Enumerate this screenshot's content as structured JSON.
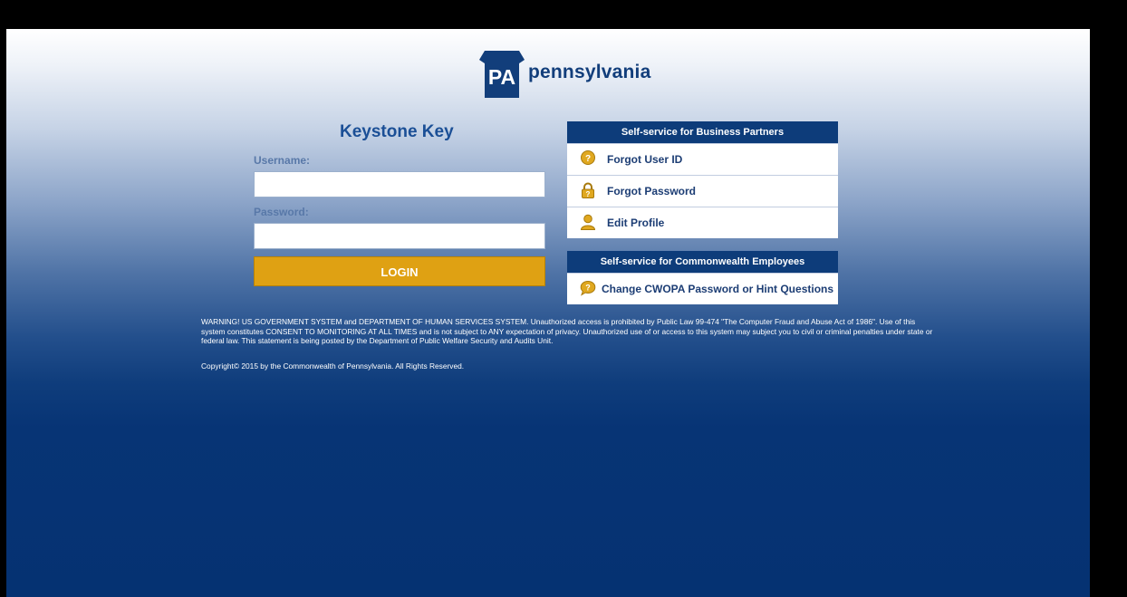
{
  "logo": {
    "badge_text": "PA",
    "name": "pennsylvania"
  },
  "login": {
    "title": "Keystone Key",
    "username_label": "Username:",
    "username_value": "",
    "password_label": "Password:",
    "password_value": "",
    "login_button": "LOGIN"
  },
  "business_partners": {
    "heading": "Self-service for Business Partners",
    "items": [
      {
        "label": "Forgot User ID",
        "icon": "question-circle-icon"
      },
      {
        "label": "Forgot Password",
        "icon": "lock-icon"
      },
      {
        "label": "Edit Profile",
        "icon": "user-icon"
      }
    ]
  },
  "employees": {
    "heading": "Self-service for Commonwealth Employees",
    "items": [
      {
        "label": "Change CWOPA Password or Hint Questions",
        "icon": "chat-question-icon"
      }
    ]
  },
  "footer": {
    "warning": "WARNING! US GOVERNMENT SYSTEM and DEPARTMENT OF HUMAN SERVICES SYSTEM. Unauthorized access is prohibited by Public Law 99-474 \"The Computer Fraud and Abuse Act of 1986\". Use of this system constitutes CONSENT TO MONITORING AT ALL TIMES and is not subject to ANY expectation of privacy. Unauthorized use of or access to this system may subject you to civil or criminal penalties under state or federal law. This statement is being posted by the Department of Public Welfare Security and Audits Unit.",
    "copyright": "Copyright© 2015 by the Commonwealth of Pennsylvania. All Rights Reserved."
  },
  "colors": {
    "brand_blue": "#0d3c7a",
    "accent_gold": "#dfa113",
    "icon_gold": "#e0a820"
  }
}
